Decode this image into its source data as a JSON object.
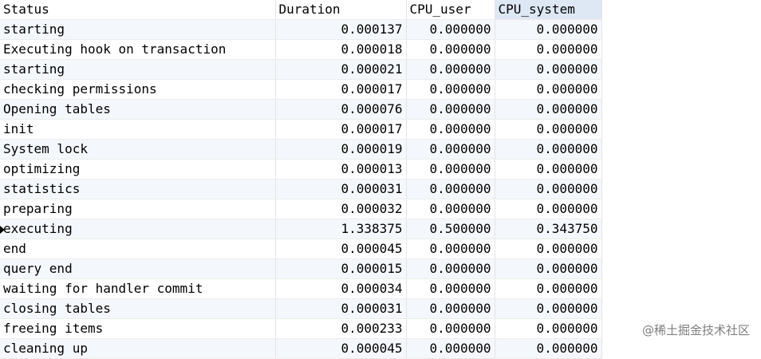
{
  "table": {
    "columns": [
      "Status",
      "Duration",
      "CPU_user",
      "CPU_system"
    ],
    "selected_column": 3,
    "current_row": 10,
    "rows": [
      [
        "starting",
        "0.000137",
        "0.000000",
        "0.000000"
      ],
      [
        "Executing hook on transaction",
        "0.000018",
        "0.000000",
        "0.000000"
      ],
      [
        "starting",
        "0.000021",
        "0.000000",
        "0.000000"
      ],
      [
        "checking permissions",
        "0.000017",
        "0.000000",
        "0.000000"
      ],
      [
        "Opening tables",
        "0.000076",
        "0.000000",
        "0.000000"
      ],
      [
        "init",
        "0.000017",
        "0.000000",
        "0.000000"
      ],
      [
        "System lock",
        "0.000019",
        "0.000000",
        "0.000000"
      ],
      [
        "optimizing",
        "0.000013",
        "0.000000",
        "0.000000"
      ],
      [
        "statistics",
        "0.000031",
        "0.000000",
        "0.000000"
      ],
      [
        "preparing",
        "0.000032",
        "0.000000",
        "0.000000"
      ],
      [
        "executing",
        "1.338375",
        "0.500000",
        "0.343750"
      ],
      [
        "end",
        "0.000045",
        "0.000000",
        "0.000000"
      ],
      [
        "query end",
        "0.000015",
        "0.000000",
        "0.000000"
      ],
      [
        "waiting for handler commit",
        "0.000034",
        "0.000000",
        "0.000000"
      ],
      [
        "closing tables",
        "0.000031",
        "0.000000",
        "0.000000"
      ],
      [
        "freeing items",
        "0.000233",
        "0.000000",
        "0.000000"
      ],
      [
        "cleaning up",
        "0.000045",
        "0.000000",
        "0.000000"
      ]
    ]
  },
  "watermark": "@稀土掘金技术社区",
  "colors": {
    "selected_header": "#dde8f4",
    "alt_row": "#f4f7fb",
    "grid_line": "#e4e4e4"
  }
}
